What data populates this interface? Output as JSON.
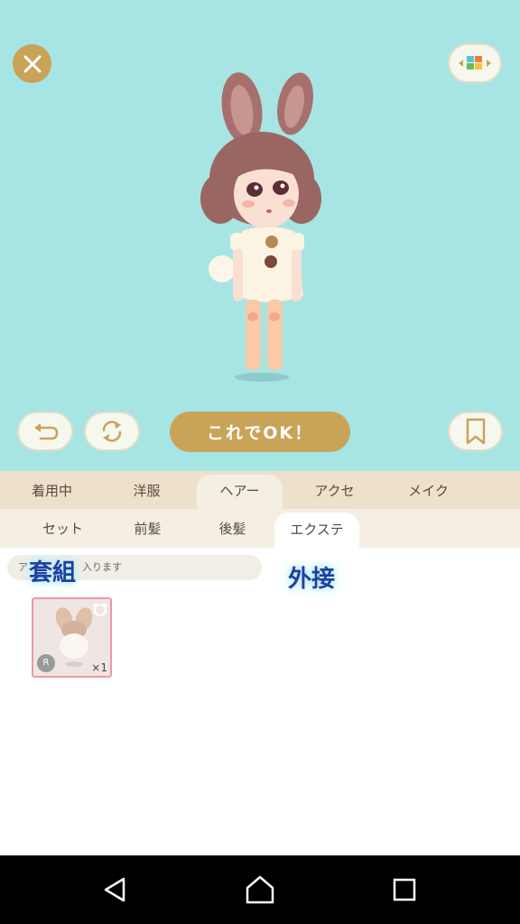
{
  "toolbar": {
    "close_icon": "close-icon",
    "palette_icon": "color-palette-icon",
    "undo_icon": "undo-icon",
    "rotate_icon": "rotate-icon",
    "ok_label": "これでOK！",
    "bookmark_icon": "bookmark-icon"
  },
  "category_tabs": [
    {
      "label": "着用中",
      "active": false
    },
    {
      "label": "洋服",
      "active": false
    },
    {
      "label": "ヘアー",
      "active": true
    },
    {
      "label": "アクセ",
      "active": false
    },
    {
      "label": "メイク",
      "active": false
    }
  ],
  "sub_tabs": [
    {
      "label": "セット",
      "active": false
    },
    {
      "label": "前髪",
      "active": false
    },
    {
      "label": "後髪",
      "active": false
    },
    {
      "label": "エクステ",
      "active": true
    }
  ],
  "filter": {
    "text_start": "ア",
    "text_end": "入ります"
  },
  "overlays": {
    "left": "套組",
    "right": "外接"
  },
  "items": [
    {
      "rarity": "R",
      "count": "×1"
    }
  ],
  "colors": {
    "stage_bg": "#a6e5e4",
    "accent_gold": "#c9a458",
    "tab_bar": "#ede1cc",
    "selected_border": "#e99aa6"
  }
}
